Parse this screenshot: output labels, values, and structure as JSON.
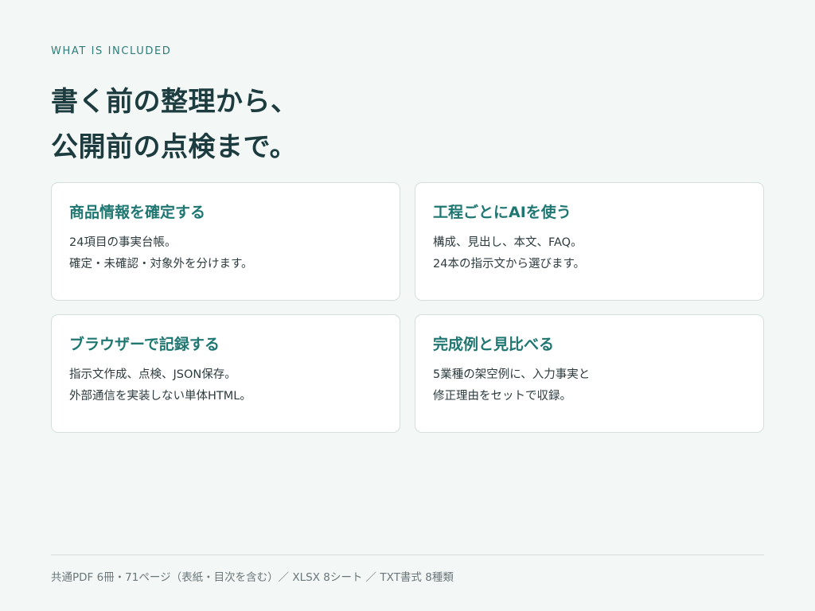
{
  "eyebrow": "WHAT IS INCLUDED",
  "headline": {
    "line1": "書く前の整理から、",
    "line2": "公開前の点検まで。"
  },
  "cards": [
    {
      "title": "商品情報を確定する",
      "lines": [
        "24項目の事実台帳。",
        "確定・未確認・対象外を分けます。"
      ]
    },
    {
      "title": "工程ごとにAIを使う",
      "lines": [
        "構成、見出し、本文、FAQ。",
        "24本の指示文から選びます。"
      ]
    },
    {
      "title": "ブラウザーで記録する",
      "lines": [
        "指示文作成、点検、JSON保存。",
        "外部通信を実装しない単体HTML。"
      ]
    },
    {
      "title": "完成例と見比べる",
      "lines": [
        "5業種の架空例に、入力事実と",
        "修正理由をセットで収録。"
      ]
    }
  ],
  "footer": "共通PDF 6冊・71ページ（表紙・目次を含む）／ XLSX 8シート ／ TXT書式 8種類",
  "colors": {
    "background": "#f3f7f5",
    "accent": "#1f7772",
    "headline": "#1c3c40",
    "card_border": "#d6dfdc"
  }
}
